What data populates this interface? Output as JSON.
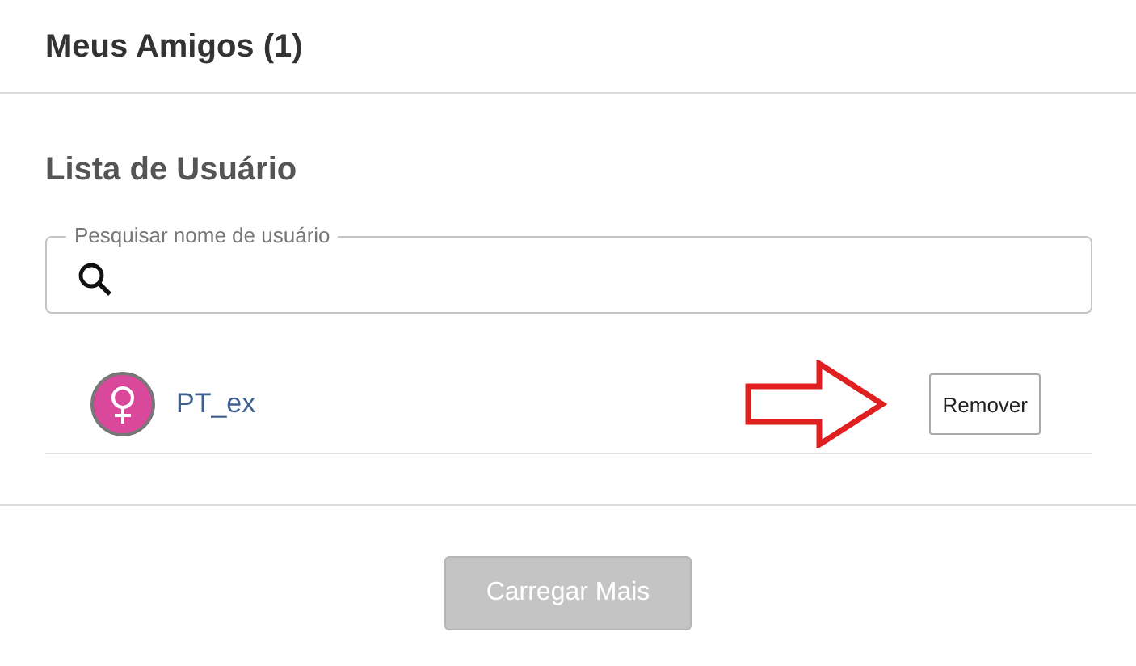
{
  "header": {
    "title": "Meus Amigos (1)"
  },
  "section": {
    "title": "Lista de Usuário"
  },
  "search": {
    "label": "Pesquisar nome de usuário"
  },
  "users": [
    {
      "name": "PT_ex",
      "action": "Remover"
    }
  ],
  "load_more": {
    "label": "Carregar Mais",
    "disabled": true
  }
}
